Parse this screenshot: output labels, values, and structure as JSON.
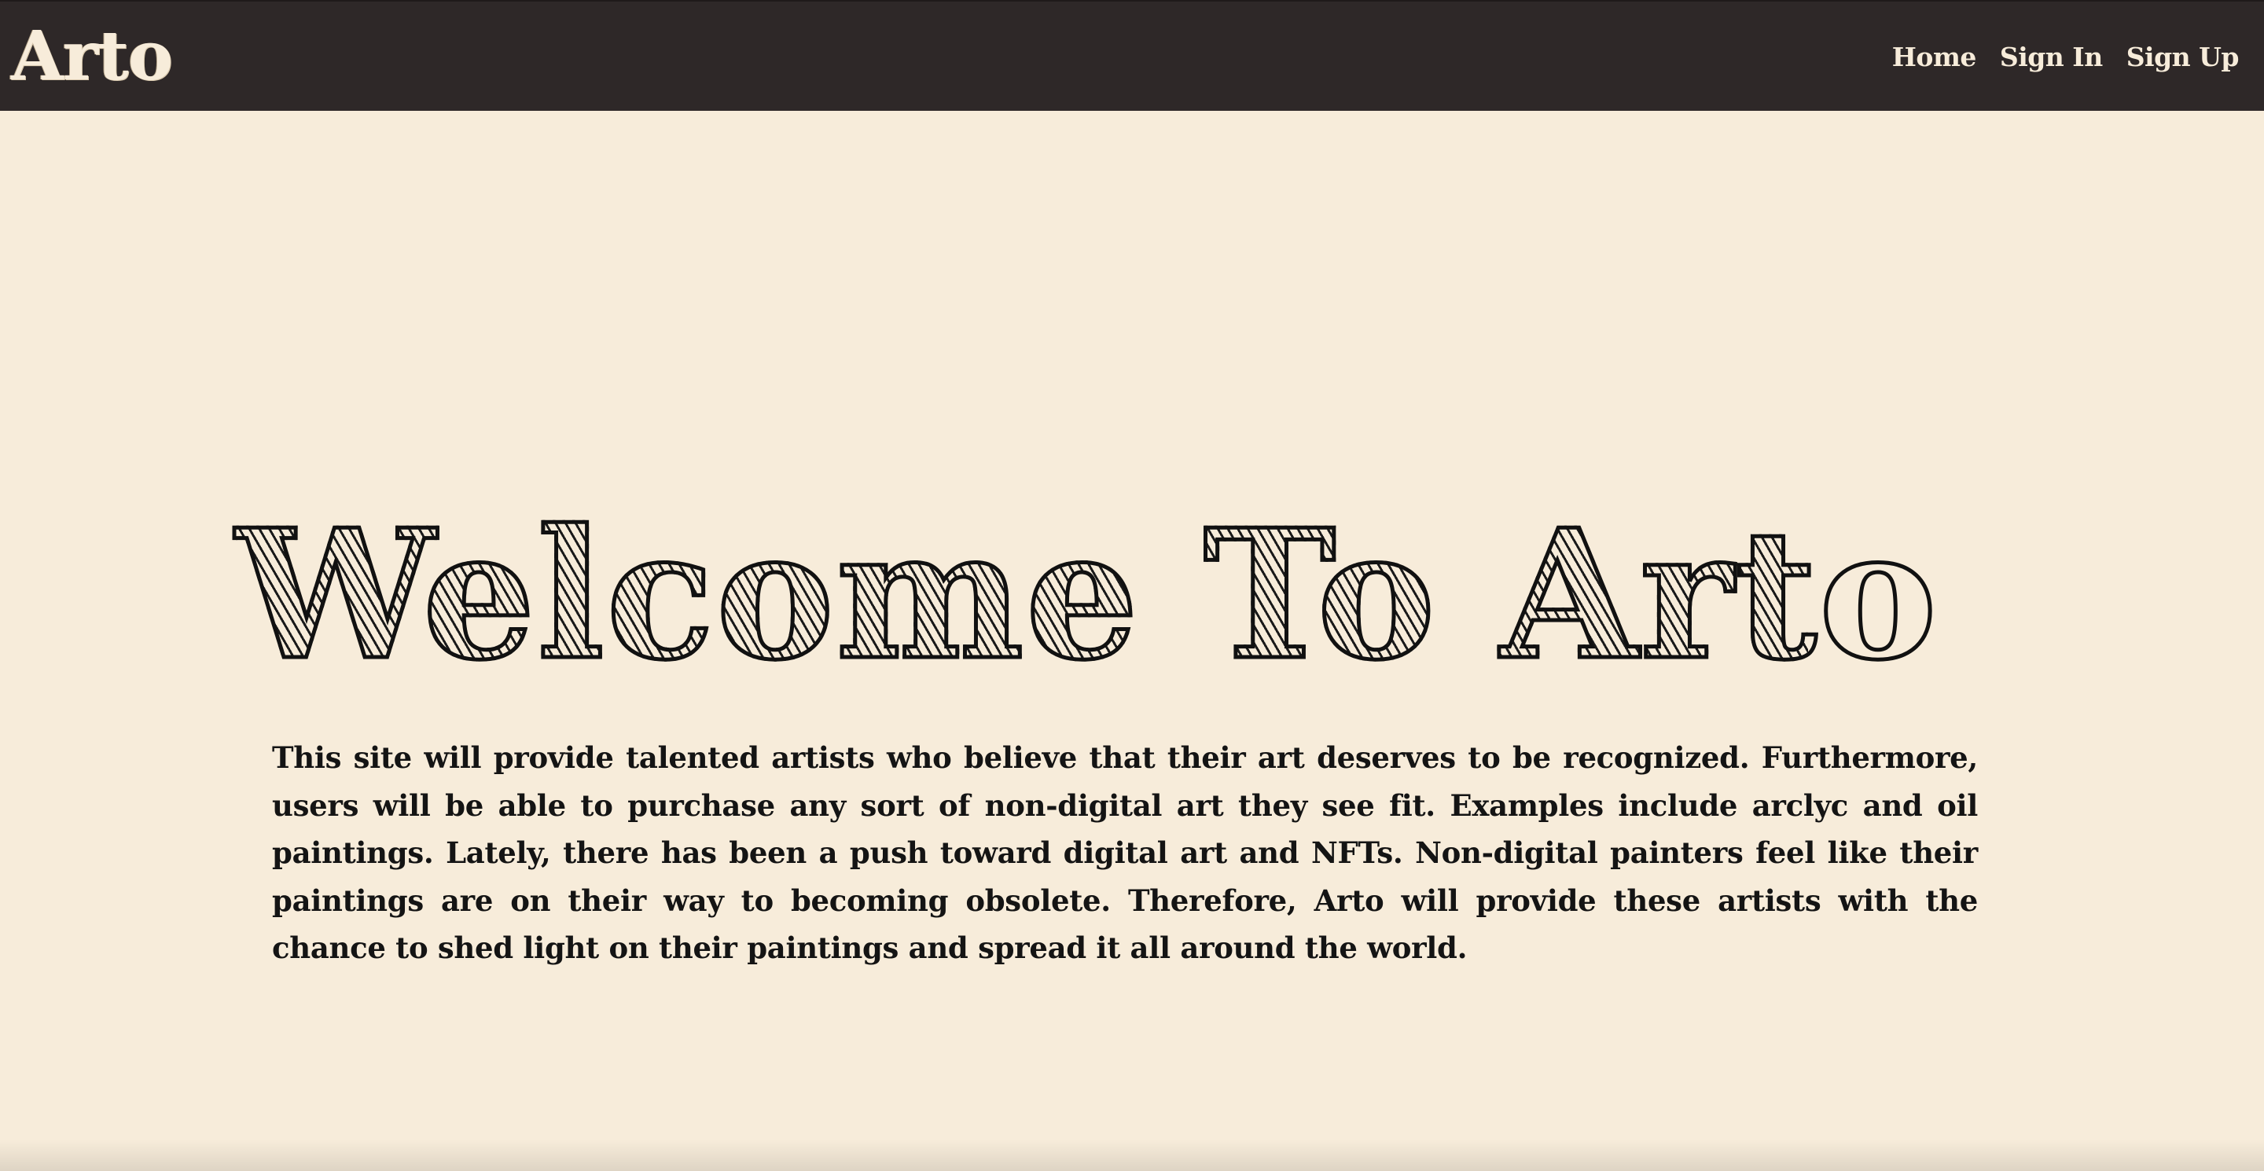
{
  "navbar": {
    "brand": "Arto",
    "links": [
      {
        "label": "Home"
      },
      {
        "label": "Sign In"
      },
      {
        "label": "Sign Up"
      }
    ]
  },
  "hero": {
    "title": "Welcome To Arto",
    "description": "This site will provide talented artists who believe that their art deserves to be recognized. Furthermore, users will be able to purchase any sort of non-digital art they see fit. Examples include arclyc and oil paintings. Lately, there has been a push toward digital art and NFTs. Non-digital painters feel like their paintings are on their way to becoming obsolete. Therefore, Arto will provide these artists with the chance to shed light on their paintings and spread it all around the world."
  },
  "colors": {
    "navbar_bg": "#2e2828",
    "page_bg": "#f7ecda",
    "text": "#141414",
    "nav_text": "#f7ecda"
  }
}
